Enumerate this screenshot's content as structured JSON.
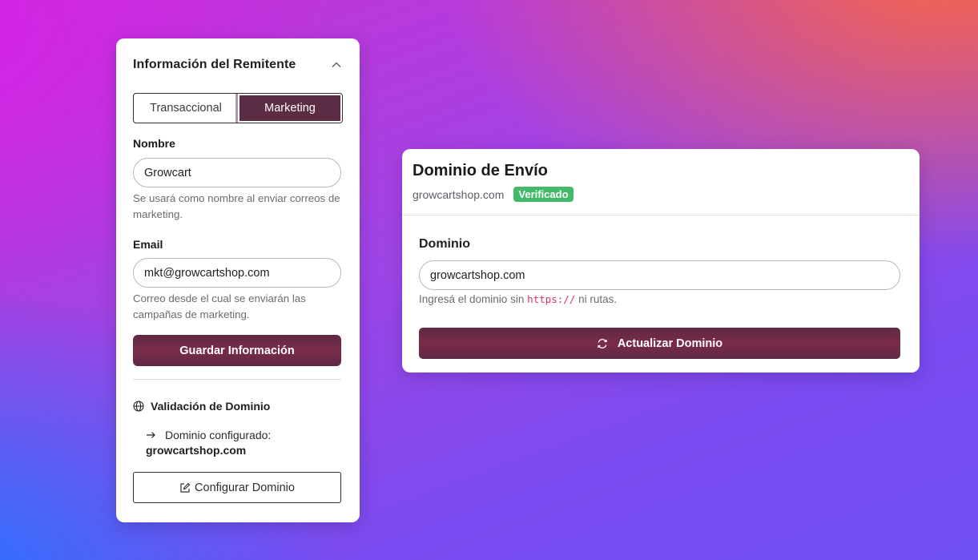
{
  "sender_panel": {
    "title": "Información del Remitente",
    "tabs": [
      "Transaccional",
      "Marketing"
    ],
    "active_tab": "Marketing",
    "name_label": "Nombre",
    "name_value": "Growcart",
    "name_help": "Se usará como nombre al enviar correos de marketing.",
    "email_label": "Email",
    "email_value": "mkt@growcartshop.com",
    "email_help": "Correo desde el cual se enviarán las campañas de marketing.",
    "save_button": "Guardar Información",
    "validation_title": "Validación de Dominio",
    "configured_label": "Dominio configurado:",
    "configured_value": "growcartshop.com",
    "configure_button": "Configurar Dominio"
  },
  "domain_panel": {
    "title": "Dominio de Envío",
    "domain_text": "growcartshop.com",
    "status_badge": "Verificado",
    "field_label": "Dominio",
    "field_value": "growcartshop.com",
    "help_prefix": "Ingresá el dominio sin",
    "help_code": "https://",
    "help_suffix": "ni rutas.",
    "update_button": "Actualizar Dominio"
  },
  "colors": {
    "primary": "#5e2a45",
    "badge_green": "#43b96b",
    "code_pink": "#d6326c"
  },
  "icons": [
    "chevron-up-icon",
    "globe-icon",
    "arrow-right-icon",
    "edit-icon",
    "refresh-icon"
  ]
}
